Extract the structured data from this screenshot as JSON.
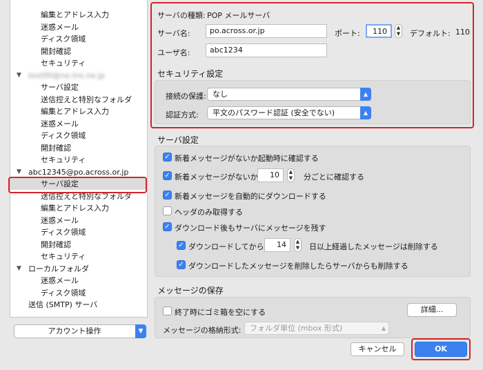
{
  "sidebar": {
    "items": [
      {
        "label": "編集とアドレス入力",
        "level": 1
      },
      {
        "label": "迷惑メール",
        "level": 1
      },
      {
        "label": "ディスク領域",
        "level": 1
      },
      {
        "label": "開封確認",
        "level": 1
      },
      {
        "label": "セキュリティ",
        "level": 1
      },
      {
        "label": "test00@ne.tns.ne.jp",
        "level": 0,
        "blurred": true
      },
      {
        "label": "サーバ設定",
        "level": 1
      },
      {
        "label": "送信控えと特別なフォルダ",
        "level": 1
      },
      {
        "label": "編集とアドレス入力",
        "level": 1
      },
      {
        "label": "迷惑メール",
        "level": 1
      },
      {
        "label": "ディスク領域",
        "level": 1
      },
      {
        "label": "開封確認",
        "level": 1
      },
      {
        "label": "セキュリティ",
        "level": 1
      },
      {
        "label": "abc12345@po.across.or.jp",
        "level": 0
      },
      {
        "label": "サーバ設定",
        "level": 1,
        "selected": true
      },
      {
        "label": "送信控えと特別なフォルダ",
        "level": 1
      },
      {
        "label": "編集とアドレス入力",
        "level": 1
      },
      {
        "label": "迷惑メール",
        "level": 1
      },
      {
        "label": "ディスク領域",
        "level": 1
      },
      {
        "label": "開封確認",
        "level": 1
      },
      {
        "label": "セキュリティ",
        "level": 1
      },
      {
        "label": "ローカルフォルダ",
        "level": 0
      },
      {
        "label": "迷惑メール",
        "level": 1
      },
      {
        "label": "ディスク領域",
        "level": 1
      },
      {
        "label": "送信 (SMTP) サーバ",
        "level": 0,
        "noTri": true
      }
    ],
    "account_actions": "アカウント操作"
  },
  "server": {
    "type_label": "サーバの種類:",
    "type_value": "POP メールサーバ",
    "name_label": "サーバ名:",
    "name_value": "po.across.or.jp",
    "port_label": "ポート:",
    "port_value": "110",
    "default_label": "デフォルト:",
    "default_value": "110",
    "user_label": "ユーザ名:",
    "user_value": "abc1234"
  },
  "security": {
    "title": "セキュリティ設定",
    "conn_label": "接続の保護:",
    "conn_value": "なし",
    "auth_label": "認証方式:",
    "auth_value": "平文のパスワード認証 (安全でない)"
  },
  "server_settings": {
    "title": "サーバ設定",
    "check_startup": "新着メッセージがないか起動時に確認する",
    "check_every_pre": "新着メッセージがないか",
    "check_every_value": "10",
    "check_every_post": "分ごとに確認する",
    "auto_download": "新着メッセージを自動的にダウンロードする",
    "headers_only": "ヘッダのみ取得する",
    "leave_on_server": "ダウンロード後もサーバにメッセージを残す",
    "delete_after_pre": "ダウンロードしてから",
    "delete_after_value": "14",
    "delete_after_post": "日以上経過したメッセージは削除する",
    "delete_from_server": "ダウンロードしたメッセージを削除したらサーバからも削除する"
  },
  "storage": {
    "title": "メッセージの保存",
    "empty_trash": "終了時にゴミ箱を空にする",
    "details_button": "詳細...",
    "format_label": "メッセージの格納形式:",
    "format_value": "フォルダ単位 (mbox 形式)"
  },
  "footer": {
    "cancel": "キャンセル",
    "ok": "OK"
  }
}
